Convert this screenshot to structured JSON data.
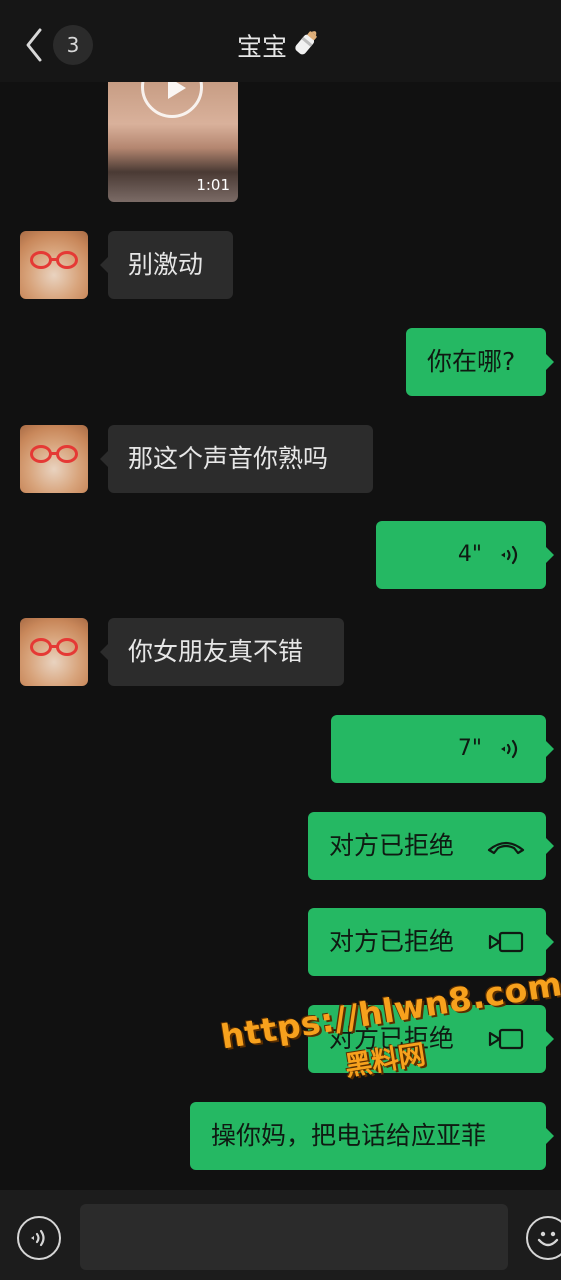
{
  "header": {
    "back_label": "<",
    "unread_count": "3",
    "title": "宝宝",
    "title_emoji": "baby-bottle-icon"
  },
  "messages": [
    {
      "type": "video",
      "side": "in",
      "duration": "1:01"
    },
    {
      "type": "text",
      "side": "in",
      "text": "别激动"
    },
    {
      "type": "text",
      "side": "out",
      "text": "你在哪?"
    },
    {
      "type": "text",
      "side": "in",
      "text": "那这个声音你熟吗"
    },
    {
      "type": "voice",
      "side": "out",
      "duration": "4\""
    },
    {
      "type": "text",
      "side": "in",
      "text": "你女朋友真不错"
    },
    {
      "type": "voice",
      "side": "out",
      "duration": "7\""
    },
    {
      "type": "call",
      "side": "out",
      "text": "对方已拒绝",
      "icon": "phone-icon"
    },
    {
      "type": "call",
      "side": "out",
      "text": "对方已拒绝",
      "icon": "video-call-icon"
    },
    {
      "type": "call",
      "side": "out",
      "text": "对方已拒绝",
      "icon": "video-call-icon"
    },
    {
      "type": "text",
      "side": "out",
      "text": "操你妈，把电话给应亚菲"
    }
  ],
  "watermark": {
    "url": "https://hlwn8.com",
    "label": "黑料网"
  },
  "footer": {
    "input_placeholder": "",
    "voice_icon": "voice-toggle-icon",
    "emoji_icon": "emoji-icon"
  },
  "colors": {
    "background": "#111111",
    "incoming_bubble": "#2c2c2c",
    "outgoing_bubble": "#25b863",
    "watermark": "#f7a11d"
  }
}
